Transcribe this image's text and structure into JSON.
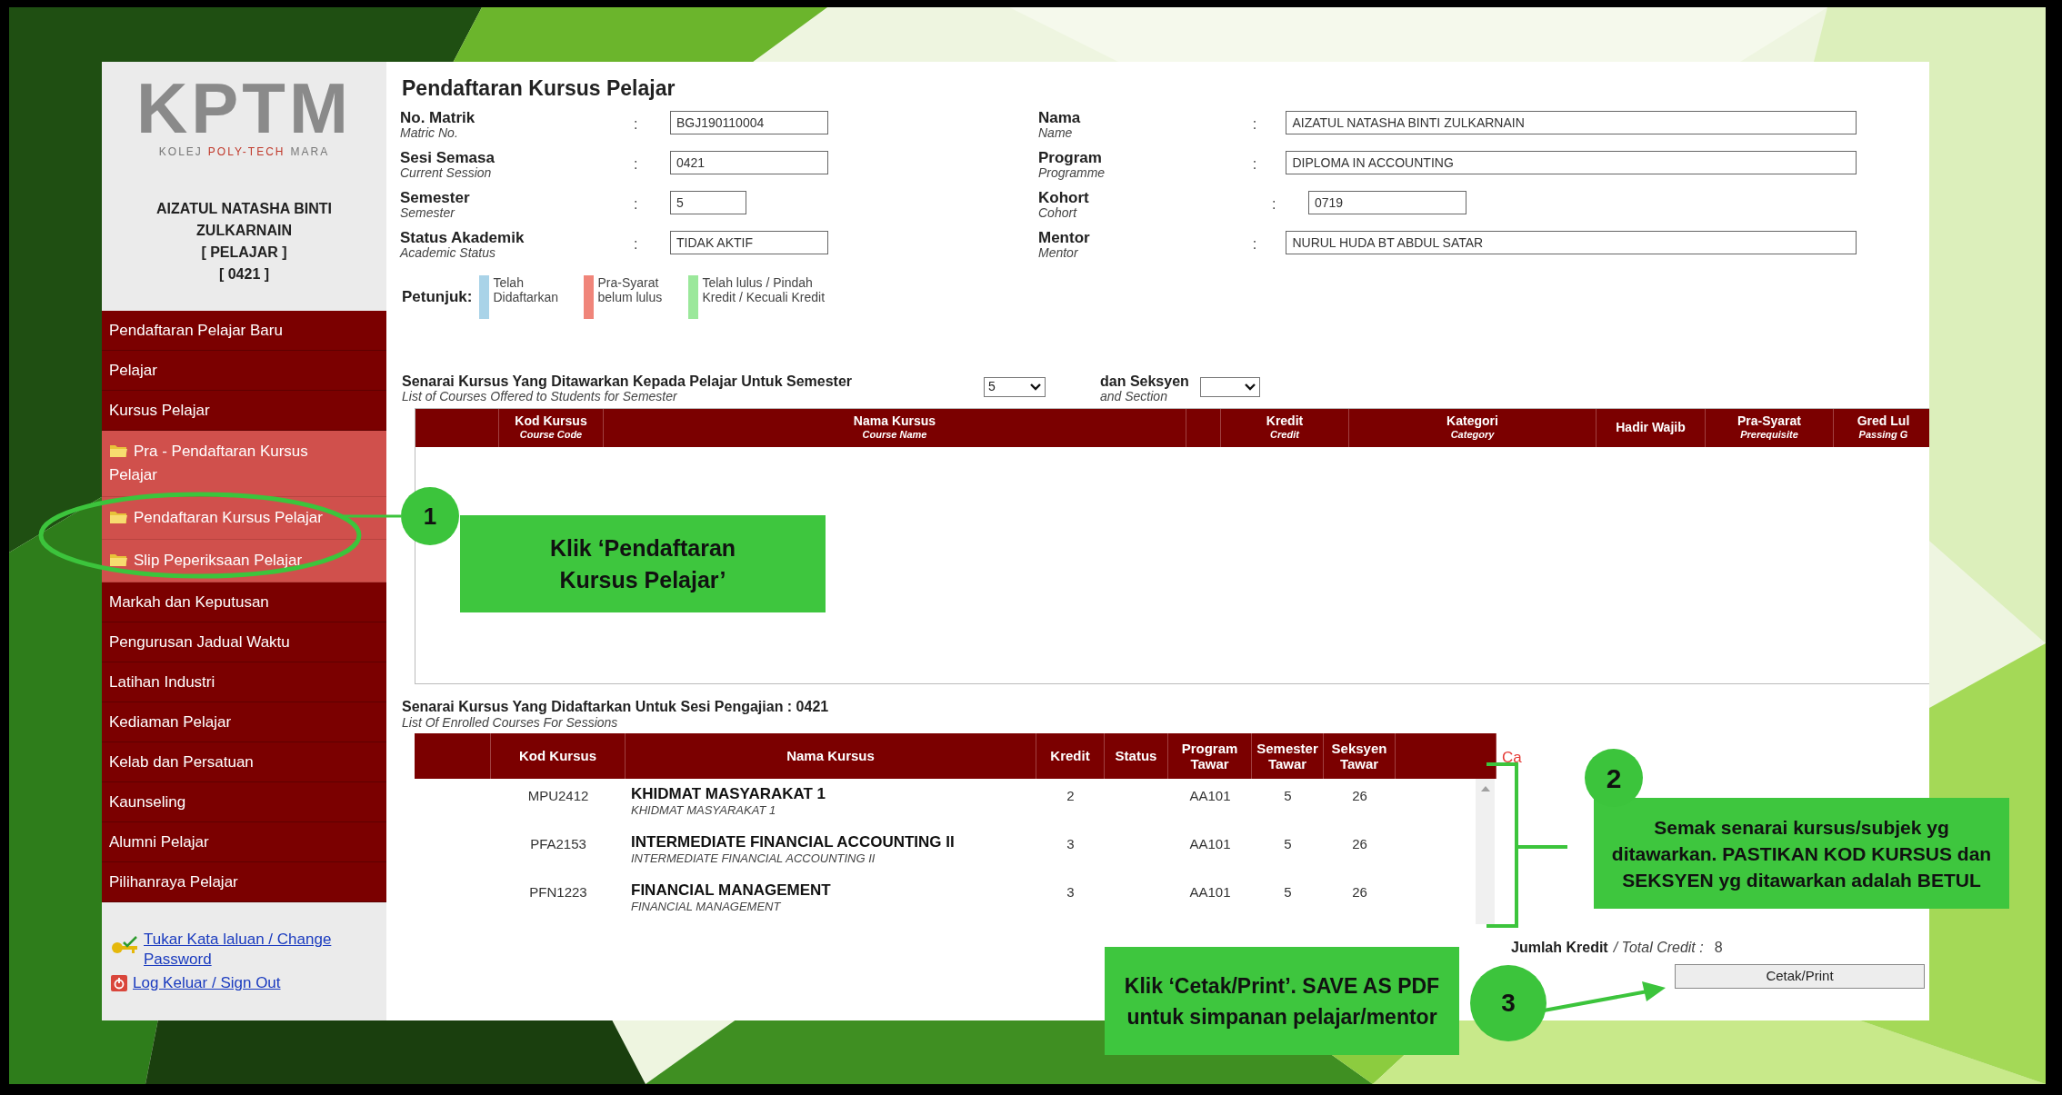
{
  "sidebar": {
    "logo": {
      "mark": "KPTM",
      "tagline": [
        "KOLEJ",
        "POLY-TECH",
        "MARA"
      ]
    },
    "user": {
      "name": "AIZATUL NATASHA BINTI ZULKARNAIN",
      "role": "[ PELAJAR ]",
      "session": "[ 0421 ]"
    },
    "menu": [
      {
        "label": "Pendaftaran Pelajar Baru",
        "kind": "main"
      },
      {
        "label": "Pelajar",
        "kind": "main"
      },
      {
        "label": "Kursus Pelajar",
        "kind": "main"
      },
      {
        "label": "Pra - Pendaftaran Kursus Pelajar",
        "kind": "folder"
      },
      {
        "label": "Pendaftaran Kursus Pelajar",
        "kind": "folder"
      },
      {
        "label": "Slip Peperiksaan Pelajar",
        "kind": "folder"
      },
      {
        "label": "Markah dan Keputusan",
        "kind": "main"
      },
      {
        "label": "Pengurusan Jadual Waktu",
        "kind": "main"
      },
      {
        "label": "Latihan Industri",
        "kind": "main"
      },
      {
        "label": "Kediaman Pelajar",
        "kind": "main"
      },
      {
        "label": "Kelab dan Persatuan",
        "kind": "main"
      },
      {
        "label": "Kaunseling",
        "kind": "main"
      },
      {
        "label": "Alumni Pelajar",
        "kind": "main"
      },
      {
        "label": "Pilihanraya Pelajar",
        "kind": "main"
      }
    ],
    "links": [
      {
        "label": "Tukar Kata laluan / Change Password",
        "kind": "key"
      },
      {
        "label": "Log Keluar / Sign Out",
        "kind": "signout"
      }
    ]
  },
  "page": {
    "title": "Pendaftaran Kursus Pelajar",
    "fields": [
      {
        "left": {
          "label": "No. Matrik",
          "sublabel": "Matric No.",
          "colon": ":",
          "value": "BGJ190110004"
        },
        "right": {
          "label": "Nama",
          "sublabel": "Name",
          "colon": ":",
          "value": "AIZATUL NATASHA BINTI ZULKARNAIN"
        }
      },
      {
        "left": {
          "label": "Sesi Semasa",
          "sublabel": "Current Session",
          "colon": ":",
          "value": "0421"
        },
        "right": {
          "label": "Program",
          "sublabel": "Programme",
          "colon": ":",
          "value": "DIPLOMA IN ACCOUNTING"
        }
      },
      {
        "left": {
          "label": "Semester",
          "sublabel": "Semester",
          "colon": ":",
          "value": "5"
        },
        "right": {
          "label": "Kohort",
          "sublabel": "Cohort",
          "colon": ":",
          "value": "0719"
        }
      },
      {
        "left": {
          "label": "Status Akademik",
          "sublabel": "Academic Status",
          "colon": ":",
          "value": "TIDAK AKTIF"
        },
        "right": {
          "label": "Mentor",
          "sublabel": "Mentor",
          "colon": ":",
          "value": "NURUL HUDA BT ABDUL SATAR"
        }
      }
    ],
    "legend": {
      "title": "Petunjuk:",
      "items": [
        {
          "label": "Telah Didaftarkan",
          "color": "#a9d3e8"
        },
        {
          "label": "Pra-Syarat belum lulus",
          "color": "#f0857a"
        },
        {
          "label": "Telah lulus / Pindah Kredit / Kecuali Kredit",
          "color": "#9be89b"
        }
      ]
    },
    "offered": {
      "title": "Senarai Kursus Yang Ditawarkan Kepada Pelajar Untuk Semester",
      "subtitle": "List of Courses Offered to Students for Semester",
      "semester_select": "5",
      "section_label": "dan Seksyen",
      "section_sublabel": "and Section",
      "columns": [
        {
          "label": "Kod Kursus",
          "sublabel": "Course Code"
        },
        {
          "label": "Nama Kursus",
          "sublabel": "Course Name"
        },
        {
          "label": "Kredit",
          "sublabel": "Credit"
        },
        {
          "label": "Kategori",
          "sublabel": "Category"
        },
        {
          "label": "Hadir Wajib"
        },
        {
          "label": "Pra-Syarat",
          "sublabel": "Prerequisite"
        },
        {
          "label": "Gred Lul",
          "sublabel": "Passing G"
        }
      ]
    },
    "enrolled": {
      "title": "Senarai Kursus Yang Didaftarkan Untuk Sesi Pengajian : 0421",
      "subtitle": "List Of Enrolled Courses For Sessions",
      "columns": [
        "Kod Kursus",
        "Nama Kursus",
        "Kredit",
        "Status",
        "Program Tawar",
        "Semester Tawar",
        "Seksyen Tawar"
      ],
      "rows": [
        {
          "code": "MPU2412",
          "name": "KHIDMAT MASYARAKAT 1",
          "name_sub": "KHIDMAT MASYARAKAT 1",
          "credit": "2",
          "program": "AA101",
          "semester": "5",
          "section": "26"
        },
        {
          "code": "PFA2153",
          "name": "INTERMEDIATE FINANCIAL ACCOUNTING II",
          "name_sub": "INTERMEDIATE FINANCIAL ACCOUNTING II",
          "credit": "3",
          "program": "AA101",
          "semester": "5",
          "section": "26"
        },
        {
          "code": "PFN1223",
          "name": "FINANCIAL MANAGEMENT",
          "name_sub": "FINANCIAL MANAGEMENT",
          "credit": "3",
          "program": "AA101",
          "semester": "5",
          "section": "26"
        }
      ],
      "remark_fragment": "Ca",
      "total_label": "Jumlah Kredit",
      "total_sublabel": "/ Total Credit :",
      "total": "8",
      "print_button": "Cetak/Print"
    }
  },
  "annotations": [
    {
      "number": "1",
      "text": "Klik ‘Pendaftaran Kursus Pelajar’"
    },
    {
      "number": "2",
      "text": "Semak senarai kursus/subjek yg ditawarkan. PASTIKAN KOD KURSUS dan SEKSYEN yg ditawarkan adalah BETUL"
    },
    {
      "number": "3",
      "text": "Klik ‘Cetak/Print’. SAVE AS PDF untuk simpanan pelajar/mentor"
    }
  ]
}
